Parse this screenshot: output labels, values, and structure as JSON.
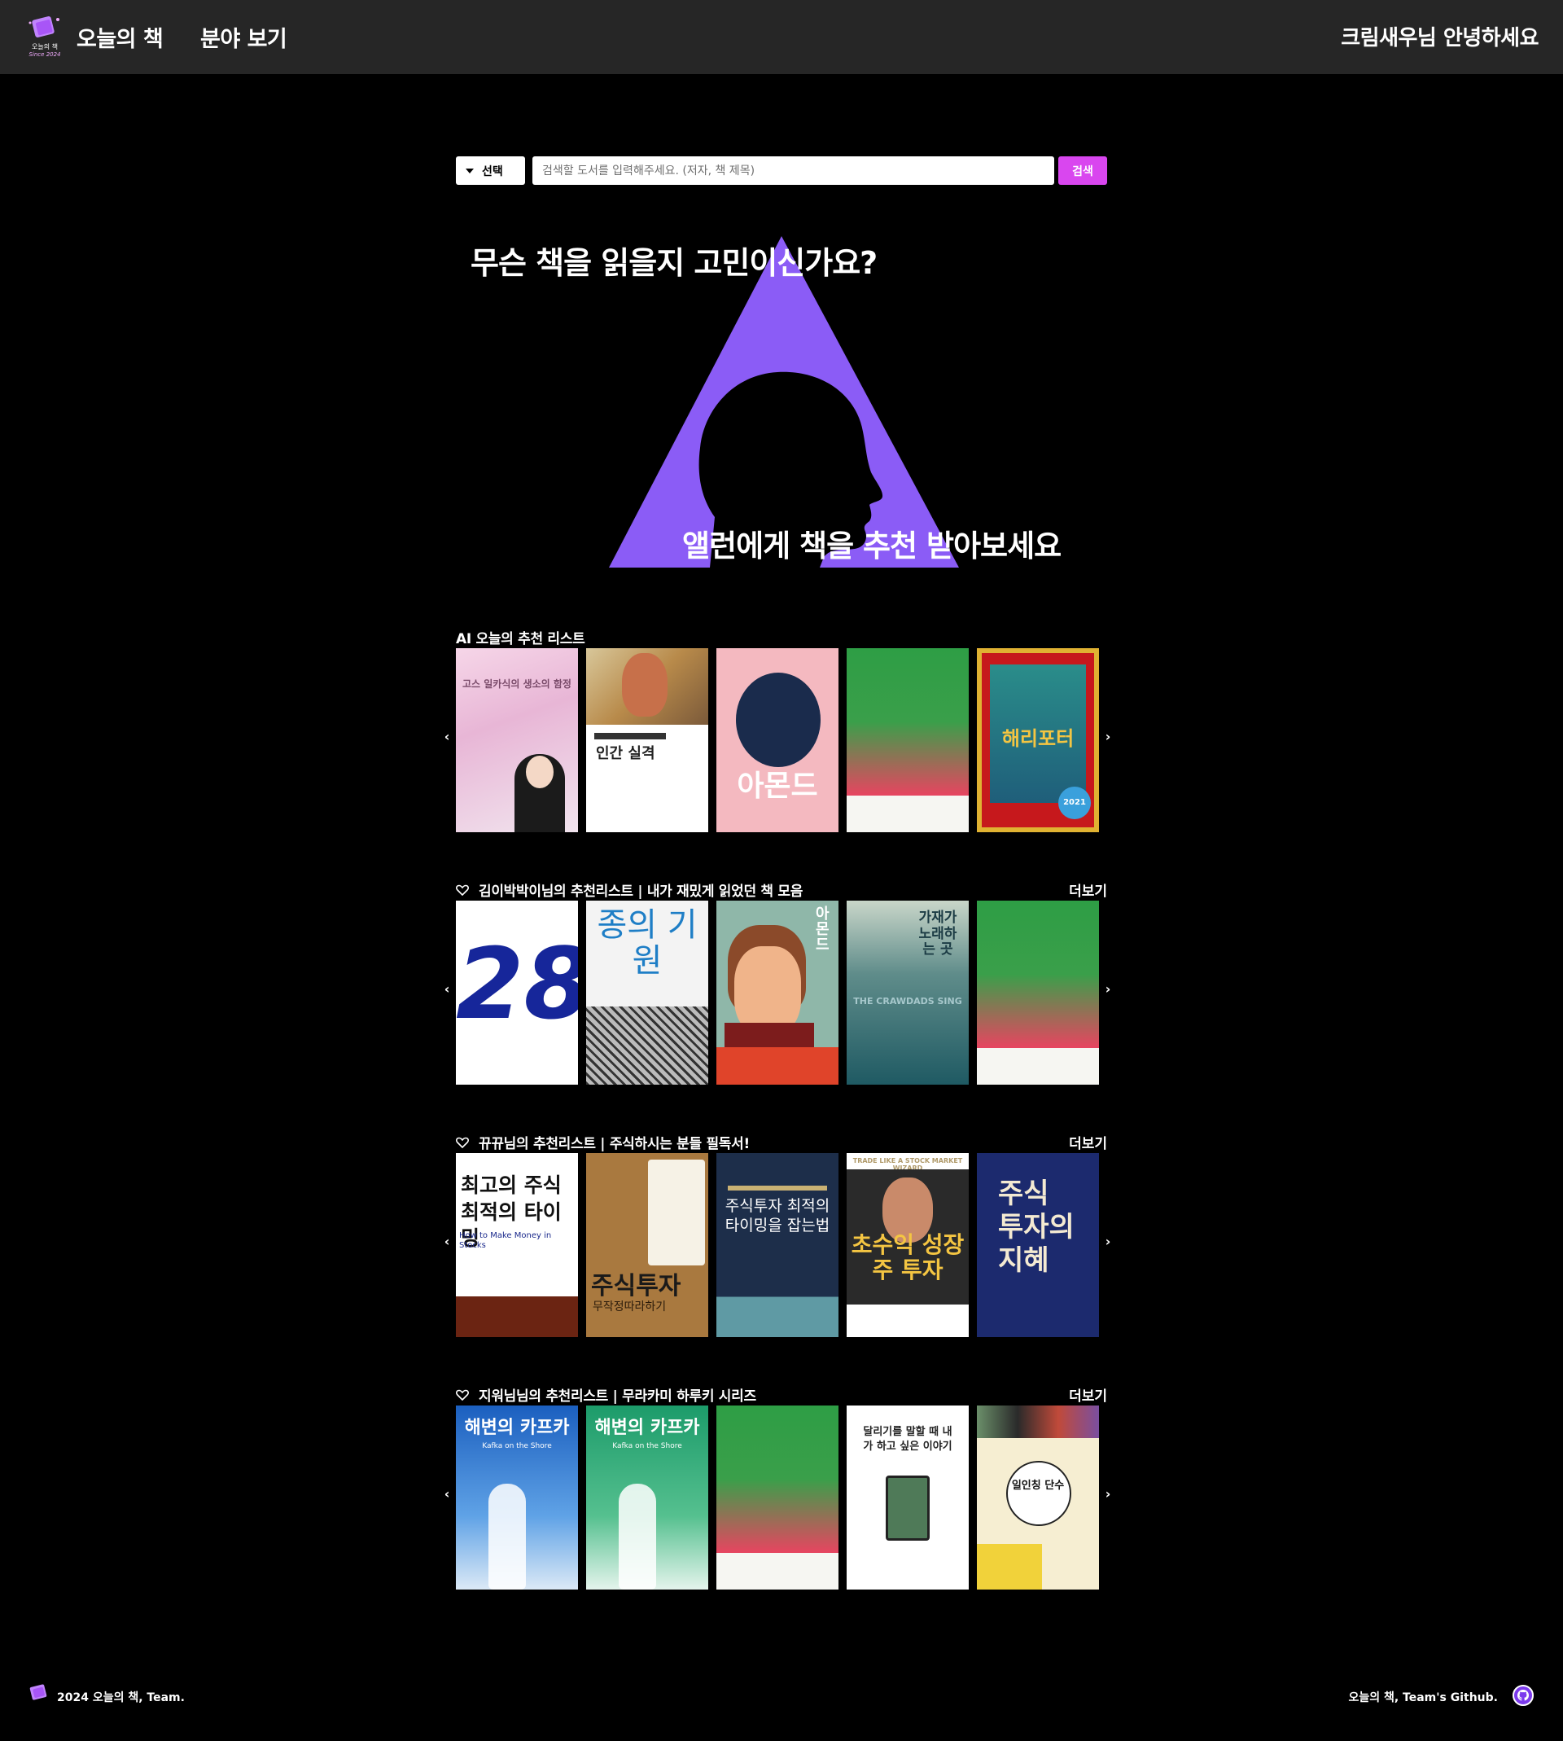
{
  "header": {
    "logo_alt_text": "오늘의 책",
    "logo_since": "Since 2024",
    "nav_home": "오늘의 책",
    "nav_category": "분야 보기",
    "greeting": "크림새우님 안녕하세요"
  },
  "search": {
    "select_label": "선택",
    "placeholder": "검색할 도서를 입력해주세요. (저자, 책 제목)",
    "button_label": "검색"
  },
  "hero": {
    "question": "무슨 책을 읽을지 고민이신가요?",
    "cta": "앨런에게 책을 추천 받아보세요"
  },
  "sections": [
    {
      "title": "AI 오늘의 추천 리스트",
      "has_heart": false,
      "more": "",
      "books": [
        {
          "cover_text": "고스 일카식의 생소의 함정",
          "sub": "",
          "icon": "book-cover"
        },
        {
          "cover_text": "인간 실격",
          "sub": "",
          "icon": "book-cover"
        },
        {
          "cover_text": "아몬드",
          "sub": "",
          "icon": "book-cover"
        },
        {
          "cover_text": "",
          "sub": "",
          "icon": "book-cover"
        },
        {
          "cover_text": "해리포터",
          "sub": "2021",
          "icon": "book-cover"
        }
      ]
    },
    {
      "title": "김이박박이님의 추천리스트 | 내가 재밌게 읽었던 책 모음",
      "has_heart": true,
      "more": "더보기",
      "books": [
        {
          "cover_text": "28",
          "sub": "",
          "icon": "book-cover"
        },
        {
          "cover_text": "종의 기원",
          "sub": "",
          "icon": "book-cover"
        },
        {
          "cover_text": "아몬드",
          "sub": "",
          "icon": "book-cover"
        },
        {
          "cover_text": "가재가 노래하는 곳",
          "sub": "THE CRAWDADS SING",
          "icon": "book-cover"
        },
        {
          "cover_text": "",
          "sub": "",
          "icon": "book-cover"
        }
      ]
    },
    {
      "title": "뀨뀨님의 추천리스트 | 주식하시는 분들 필독서!",
      "has_heart": true,
      "more": "더보기",
      "books": [
        {
          "cover_text": "최고의 주식 최적의 타이밍",
          "sub": "How to Make Money in Stocks",
          "icon": "book-cover"
        },
        {
          "cover_text": "주식투자",
          "sub": "무작정따라하기",
          "icon": "book-cover"
        },
        {
          "cover_text": "주식투자 최적의 타이밍을 잡는법",
          "sub": "",
          "icon": "book-cover"
        },
        {
          "cover_text": "초수익 성장주 투자",
          "sub": "TRADE LIKE A STOCK MARKET WIZARD",
          "icon": "book-cover"
        },
        {
          "cover_text": "주식 투자의 지혜",
          "sub": "",
          "icon": "book-cover"
        }
      ]
    },
    {
      "title": "지워님님의 추천리스트 | 무라카미 하루키 시리즈",
      "has_heart": true,
      "more": "더보기",
      "books": [
        {
          "cover_text": "해변의 카프카",
          "sub": "Kafka on the Shore",
          "icon": "book-cover"
        },
        {
          "cover_text": "해변의 카프카",
          "sub": "Kafka on the Shore",
          "icon": "book-cover"
        },
        {
          "cover_text": "",
          "sub": "",
          "icon": "book-cover"
        },
        {
          "cover_text": "달리기를 말할 때 내가 하고 싶은 이야기",
          "sub": "",
          "icon": "book-cover"
        },
        {
          "cover_text": "일인칭 단수",
          "sub": "",
          "icon": "book-cover"
        }
      ]
    }
  ],
  "carousel": {
    "prev": "‹",
    "next": "›"
  },
  "footer": {
    "left": "2024 오늘의 책, Team.",
    "right": "오늘의 책, Team's Github."
  },
  "colors": {
    "header_bg": "#262626",
    "accent": "#d946ef",
    "hero_triangle": "#8b5cf6"
  }
}
